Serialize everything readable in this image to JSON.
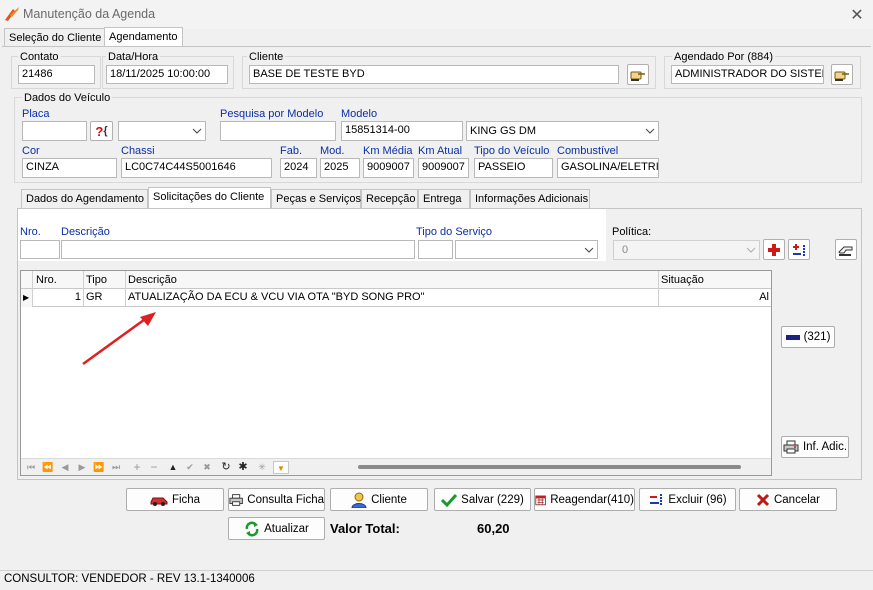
{
  "window": {
    "title": "Manutenção da Agenda",
    "close": "✕"
  },
  "main_tabs": [
    "Seleção do Cliente",
    "Agendamento"
  ],
  "header": {
    "contato_label": "Contato",
    "contato": "21486",
    "datahora_label": "Data/Hora",
    "datahora": "18/11/2025 10:00:00",
    "cliente_label": "Cliente",
    "cliente": "BASE DE TESTE BYD",
    "agendado_label": "Agendado Por (884)",
    "agendado": "ADMINISTRADOR DO SISTEMA"
  },
  "veiculo": {
    "group_label": "Dados do Veículo",
    "placa_label": "Placa",
    "placa": "",
    "placa_btn": "?",
    "pesquisa_label": "Pesquisa por Modelo",
    "pesquisa": "",
    "modelo_label": "Modelo",
    "modelo_code": "15851314-00",
    "modelo_name": "KING GS DM",
    "cor_label": "Cor",
    "cor": "CINZA",
    "chassi_label": "Chassi",
    "chassi": "LC0C74C44S5001646",
    "fab_label": "Fab.",
    "fab": "2024",
    "mod_label": "Mod.",
    "mod": "2025",
    "kmmedia_label": "Km Média",
    "kmmedia": "9009007",
    "kmatual_label": "Km Atual",
    "kmatual": "9009007",
    "tipo_label": "Tipo do Veículo",
    "tipo": "PASSEIO",
    "combustivel_label": "Combustível",
    "combustivel": "GASOLINA/ELETRIC"
  },
  "sub_tabs": [
    "Dados do Agendamento",
    "Solicitações do Cliente",
    "Peças e Serviços",
    "Recepção",
    "Entrega",
    "Informações Adicionais"
  ],
  "solicitacao": {
    "nro_label": "Nro.",
    "nro": "",
    "descricao_label": "Descrição",
    "descricao": "",
    "tipo_servico_label": "Tipo do Serviço",
    "tipo_servico": "",
    "politica_label": "Política:",
    "politica": "0"
  },
  "grid": {
    "columns": [
      "Nro.",
      "Tipo",
      "Descrição",
      "Situação"
    ],
    "rows": [
      {
        "nro": "1",
        "tipo": "GR",
        "descricao": "ATUALIZAÇÃO DA ECU & VCU VIA OTA \"BYD SONG PRO\"",
        "situacao": "Al"
      }
    ]
  },
  "side_buttons": {
    "count_btn": "(321)",
    "inf_adic": "Inf. Adic."
  },
  "actions": {
    "ficha": "Ficha",
    "consulta_ficha": "Consulta Ficha",
    "cliente": "Cliente",
    "salvar": "Salvar (229)",
    "reagendar": "Reagendar(410)",
    "excluir": "Excluir (96)",
    "cancelar": "Cancelar",
    "atualizar": "Atualizar"
  },
  "total": {
    "label": "Valor Total:",
    "value": "60,20"
  },
  "status": "CONSULTOR: VENDEDOR - REV 13.1-1340006",
  "colors": {
    "accent_blue": "#0a2ea8",
    "arrow_red": "#e02020",
    "delete_red": "#c01818"
  }
}
